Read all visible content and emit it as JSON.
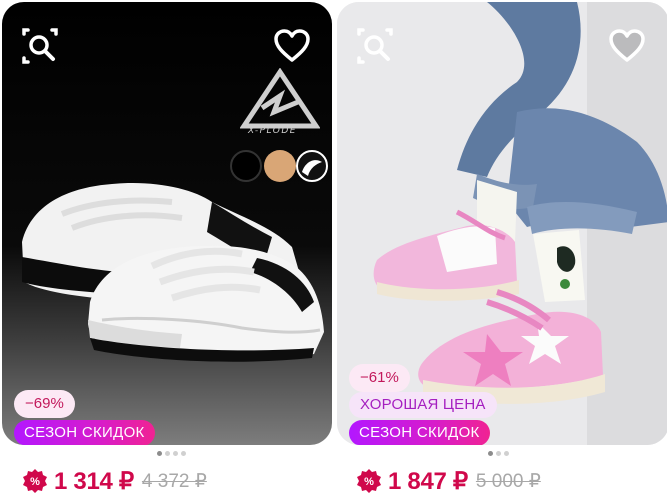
{
  "products": [
    {
      "discount": "−69%",
      "promo_label": "СЕЗОН СКИДОК",
      "price": "1 314 ₽",
      "old_price": "4 372 ₽",
      "brand": "X-PLODE",
      "colors": [
        "#000000",
        "#d9a676",
        "#111111"
      ]
    },
    {
      "discount": "−61%",
      "good_price_label": "ХОРОШАЯ ЦЕНА",
      "promo_label": "СЕЗОН СКИДОК",
      "price": "1 847 ₽",
      "old_price": "5 000 ₽"
    }
  ],
  "icons": [
    "search-similar-icon",
    "heart-icon",
    "sale-percent-icon"
  ],
  "colors": {
    "accent": "#d0084b",
    "promo_gradient_start": "#b317ff",
    "promo_gradient_end": "#f02392"
  }
}
